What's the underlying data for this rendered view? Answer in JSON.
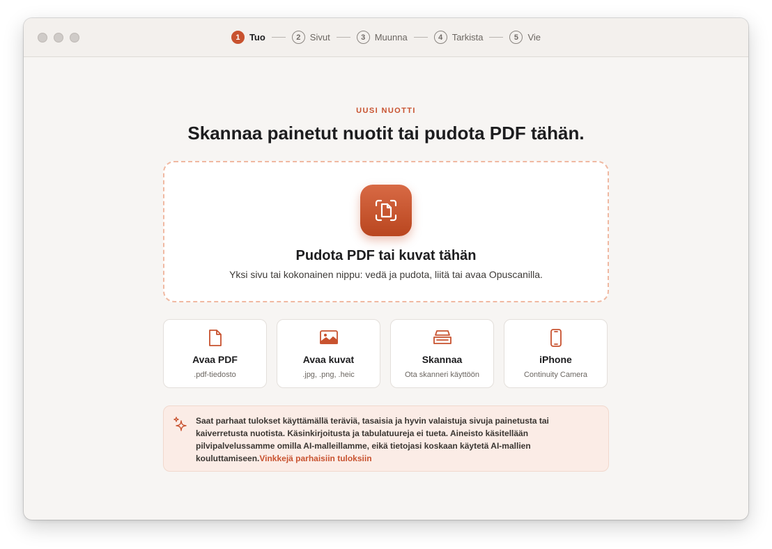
{
  "stepper": [
    {
      "num": "1",
      "label": "Tuo"
    },
    {
      "num": "2",
      "label": "Sivut"
    },
    {
      "num": "3",
      "label": "Muunna"
    },
    {
      "num": "4",
      "label": "Tarkista"
    },
    {
      "num": "5",
      "label": "Vie"
    }
  ],
  "active_step": 1,
  "main": {
    "eyebrow": "UUSI NUOTTI",
    "headline": "Skannaa painetut nuotit tai pudota PDF tähän."
  },
  "dropzone": {
    "icon": "document-scan-icon",
    "title": "Pudota PDF tai kuvat tähän",
    "subtitle": "Yksi sivu tai kokonainen nippu: vedä ja pudota, liitä tai avaa Opuscanilla."
  },
  "cards": [
    {
      "icon": "document-icon",
      "title": "Avaa PDF",
      "subtitle": ".pdf-tiedosto"
    },
    {
      "icon": "photo-icon",
      "title": "Avaa kuvat",
      "subtitle": ".jpg, .png, .heic"
    },
    {
      "icon": "scanner-icon",
      "title": "Skannaa",
      "subtitle": "Ota skanneri käyttöön"
    },
    {
      "icon": "iphone-icon",
      "title": "iPhone",
      "subtitle": "Continuity Camera"
    }
  ],
  "tip": {
    "icon": "sparkle-icon",
    "text": "Saat parhaat tulokset käyttämällä teräviä, tasaisia ja hyvin valaistuja sivuja painetusta tai kaiverretusta nuotista. Käsinkirjoitusta ja tabulatuureja ei tueta. Aineisto käsitellään pilvipalvelussamme omilla AI-malleillamme, eikä tietojasi koskaan käytetä AI-mallien kouluttamiseen.",
    "link": "Vinkkejä parhaisiin tuloksiin"
  },
  "colors": {
    "accent": "#c8522f",
    "background": "#f7f5f3",
    "tip_background": "#fbece6"
  }
}
